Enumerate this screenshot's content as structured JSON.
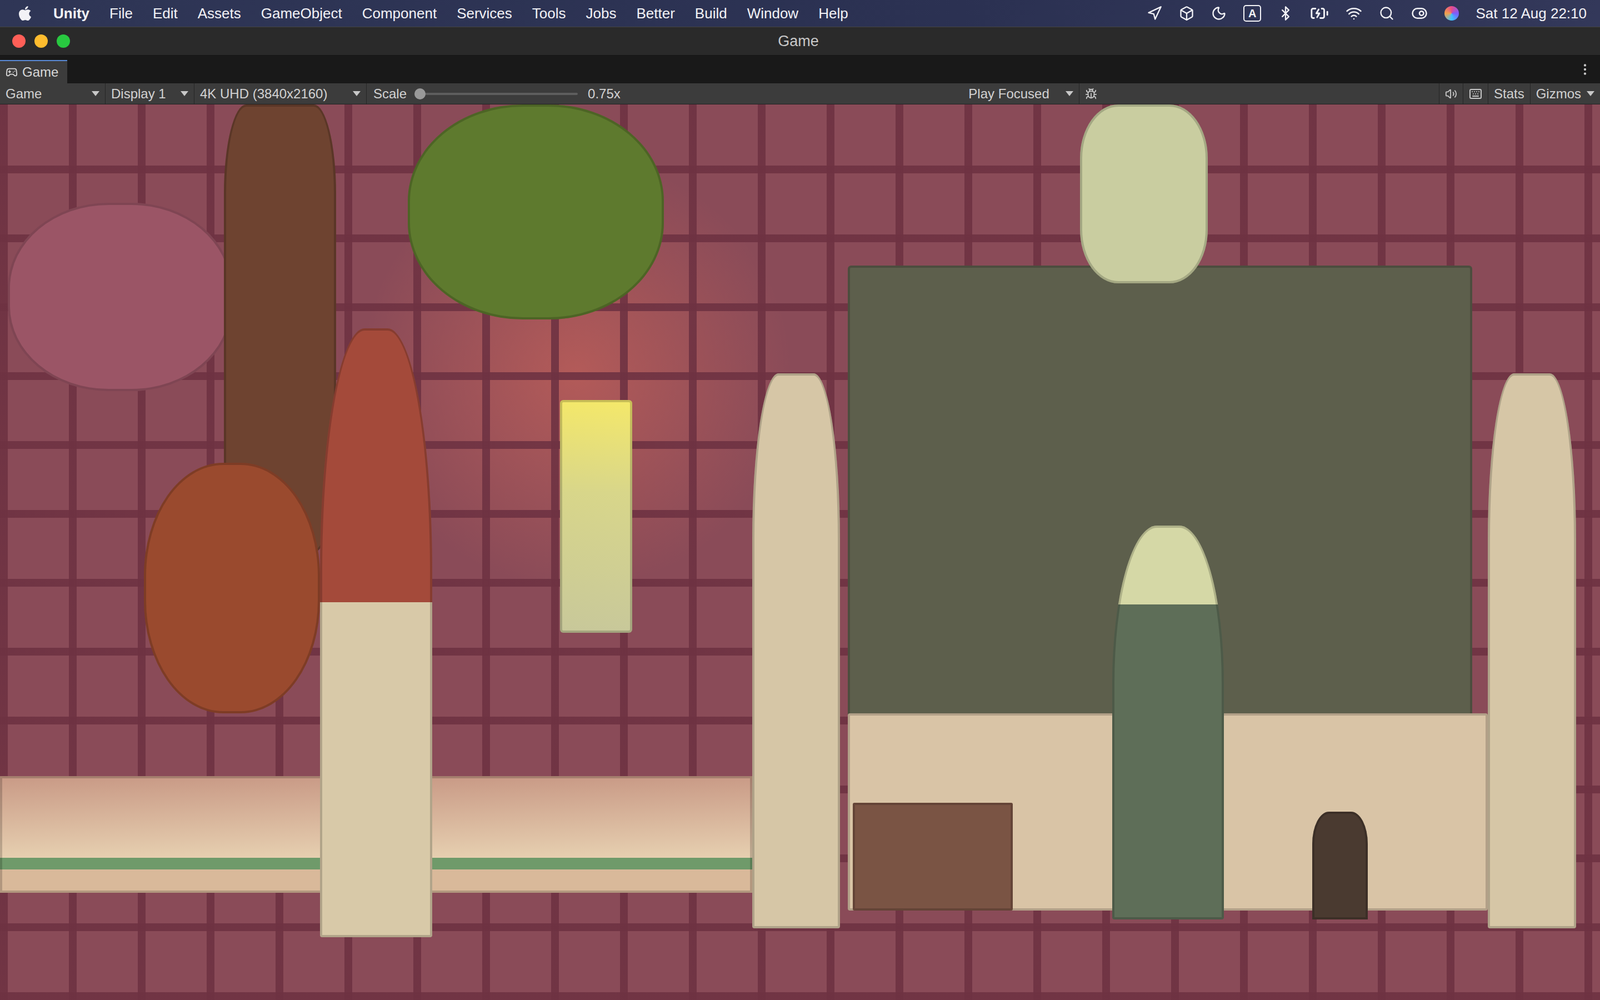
{
  "menubar": {
    "app": "Unity",
    "menus": [
      "File",
      "Edit",
      "Assets",
      "GameObject",
      "Component",
      "Services",
      "Tools",
      "Jobs",
      "Better",
      "Build",
      "Window",
      "Help"
    ],
    "input_source": "A",
    "clock": "Sat 12 Aug 22:10"
  },
  "window": {
    "title": "Game"
  },
  "tabs": [
    {
      "label": "Game",
      "selected": true
    }
  ],
  "toolbar": {
    "view_mode": "Game",
    "display": "Display 1",
    "resolution": "4K UHD (3840x2160)",
    "scale_label": "Scale",
    "scale": {
      "level": 0,
      "reading": "0.75x"
    },
    "play_mode": "Play Focused",
    "right_buttons": [
      "Stats",
      "Gizmos"
    ]
  },
  "game_view": {
    "kind": "rendered-scene"
  }
}
